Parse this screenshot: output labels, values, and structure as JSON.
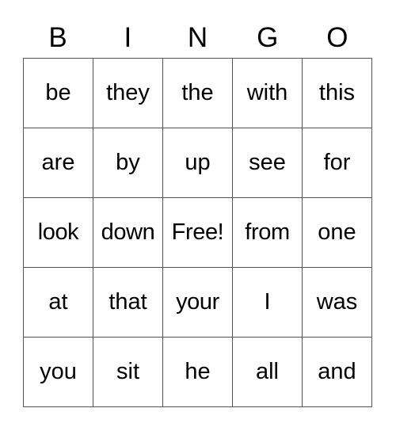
{
  "card": {
    "title": "BINGO",
    "headers": [
      "B",
      "I",
      "N",
      "G",
      "O"
    ],
    "free_space_label": "Free!",
    "colors": {
      "border": "#555555",
      "cell_background": "#ffffff",
      "text": "#000000",
      "page_background": "#ffffff"
    },
    "rows": [
      {
        "cells": [
          "be",
          "they",
          "the",
          "with",
          "this"
        ]
      },
      {
        "cells": [
          "are",
          "by",
          "up",
          "see",
          "for"
        ]
      },
      {
        "cells": [
          "look",
          "down",
          "Free!",
          "from",
          "one"
        ]
      },
      {
        "cells": [
          "at",
          "that",
          "your",
          "I",
          "was"
        ]
      },
      {
        "cells": [
          "you",
          "sit",
          "he",
          "all",
          "and"
        ]
      }
    ]
  }
}
